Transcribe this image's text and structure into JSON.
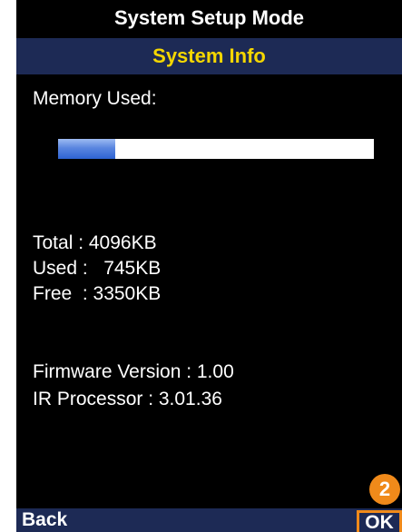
{
  "header": {
    "title": "System Setup Mode",
    "subtitle": "System Info"
  },
  "memory": {
    "label": "Memory Used:",
    "used_fraction": 0.182
  },
  "stats": {
    "total": "Total : 4096KB",
    "used": "Used :   745KB",
    "free": "Free  : 3350KB"
  },
  "versions": {
    "firmware": "Firmware Version : 1.00",
    "ir_processor": "IR Processor : 3.01.36"
  },
  "softkeys": {
    "back_label": "Back",
    "ok_label": "OK"
  },
  "callout": {
    "number": "2"
  },
  "colors": {
    "accent_yellow": "#f5d700",
    "bar_navy": "#1d2a55",
    "highlight_orange": "#f08a1a",
    "memory_fill_blue": "#2e63d4"
  }
}
